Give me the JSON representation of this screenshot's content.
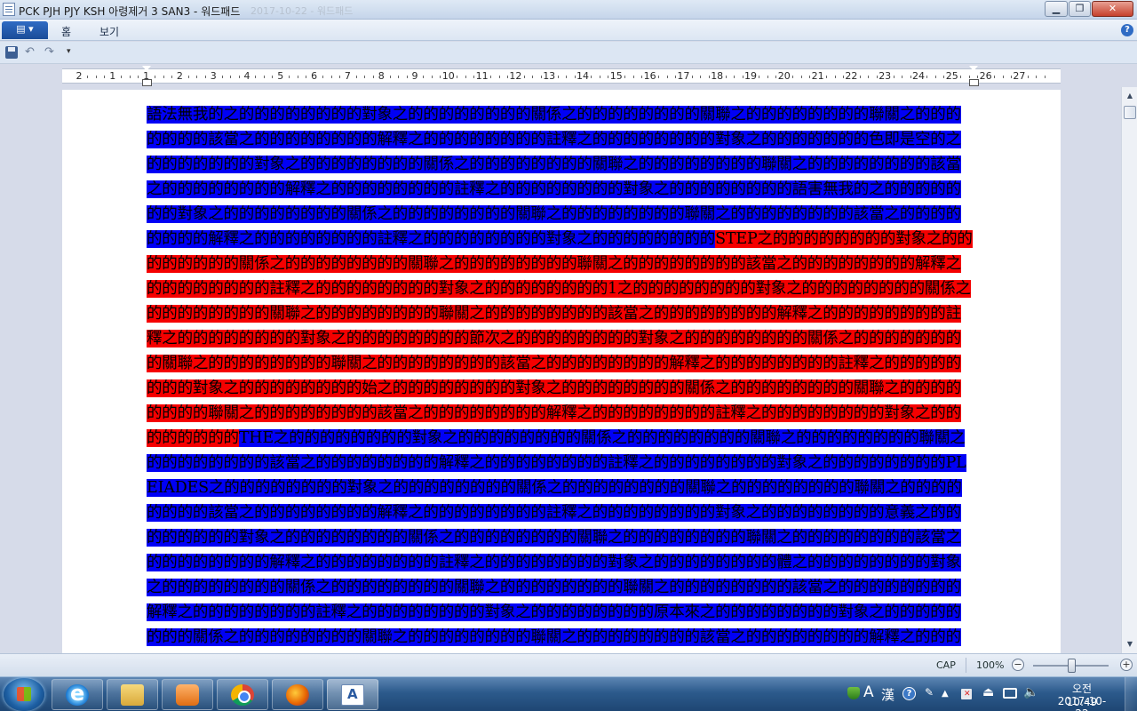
{
  "window": {
    "title": "PCK PJH PJY KSH 아령제거 3 SAN3 - 워드패드",
    "title_dim": "2017-10-22 - 워드패드"
  },
  "ribbon": {
    "tabs": [
      "홈",
      "보기"
    ],
    "help_glyph": "?"
  },
  "ruler": {
    "labels": [
      "2",
      "1",
      "1",
      "2",
      "3",
      "4",
      "5",
      "6",
      "7",
      "8",
      "9",
      "10",
      "11",
      "12",
      "13",
      "14",
      "15",
      "16",
      "17",
      "18",
      "19",
      "20",
      "21",
      "22",
      "23",
      "24",
      "25",
      "26",
      "27"
    ]
  },
  "document": {
    "colors": {
      "blue": "#0000f5",
      "red": "#f50000"
    },
    "segments": [
      {
        "color": "blue",
        "text": "語法無我的之的的的的的的的的對象之的的的的的的的的關係之的的的的的的的的關聯之的的的的的的的的聯關之的的的的的的的該當之的的的的的的的的解釋之的的的的的的的的註釋之的的的的的的的的對象之的的的的的的的色即是空的之的的的的的的的對象之的的的的的的的的關係之的的的的的的的的關聯之的的的的的的的的聯關之的的的的的的的的該當之的的的的的的的的解釋之的的的的的的的的註釋之的的的的的的的的對象之的的的的的的的的語害無我的之的的的的的的的對象之的的的的的的的的關係之的的的的的的的的關聯之的的的的的的的的聯關之的的的的的的的的該當之的的的的的的的的解釋之的的的的的的的的註釋之的的的的的的的的對象之的的的的的的的的"
      },
      {
        "color": "red",
        "text": "STEP之的的的的的的的的對象之的的的的的的的的關係之的的的的的的的的關聯之的的的的的的的的聯關之的的的的的的的的該當之的的的的的的的的解釋之的的的的的的的的註釋之的的的的的的的的對象之的的的的的的的的1之的的的的的的的的對象之的的的的的的的的關係之的的的的的的的的關聯之的的的的的的的的聯關之的的的的的的的的該當之的的的的的的的的解釋之的的的的的的的的註釋之的的的的的的的的對象之的的的的的的的的節次之的的的的的的的的對象之的的的的的的的的關係之的的的的的的的的關聯之的的的的的的的的聯關之的的的的的的的的該當之的的的的的的的的解釋之的的的的的的的的註釋之的的的的的的的的對象之的的的的的的的的始之的的的的的的的的對象之的的的的的的的的關係之的的的的的的的的關聯之的的的的的的的的聯關之的的的的的的的的該當之的的的的的的的的解釋之的的的的的的的的註釋之的的的的的的的的對象之的的的的的的的的"
      },
      {
        "color": "blue",
        "text": "THE之的的的的的的的的對象之的的的的的的的的關係之的的的的的的的的關聯之的的的的的的的的聯關之的的的的的的的的該當之的的的的的的的的解釋之的的的的的的的的註釋之的的的的的的的的對象之的的的的的的的的PLEIADES之的的的的的的的的對象之的的的的的的的的關係之的的的的的的的的關聯之的的的的的的的的聯關之的的的的的的的的該當之的的的的的的的的解釋之的的的的的的的的註釋之的的的的的的的的對象之的的的的的的的的意義之的的的的的的的的對象之的的的的的的的的關係之的的的的的的的的關聯之的的的的的的的的聯關之的的的的的的的的該當之的的的的的的的的解釋之的的的的的的的的註釋之的的的的的的的的對象之的的的的的的的的體之的的的的的的的的對象之的的的的的的的的關係之的的的的的的的的關聯之的的的的的的的的聯關之的的的的的的的的該當之的的的的的的的的解釋之的的的的的的的的註釋之的的的的的的的的對象之的的的的的的的的原本來之的的的的的的的的對象之的的的的的的的的關係之的的的的的的的的關聯之的的的的的的的的聯關之的的的的的的的的該當之的的的的的的的的解釋之的的的的的的的的註釋之的的的的的的的的對象之的的的的的的的的林鍾灌之的的的"
      }
    ]
  },
  "statusbar": {
    "cap": "CAP",
    "zoom": "100%",
    "zoom_out": "−",
    "zoom_in": "+",
    "zoom_level": 1.0
  },
  "taskbar": {
    "ime_a": "A",
    "ime_han": "漢",
    "help": "?",
    "time": "오전 10:49",
    "date": "2017-10-22"
  }
}
